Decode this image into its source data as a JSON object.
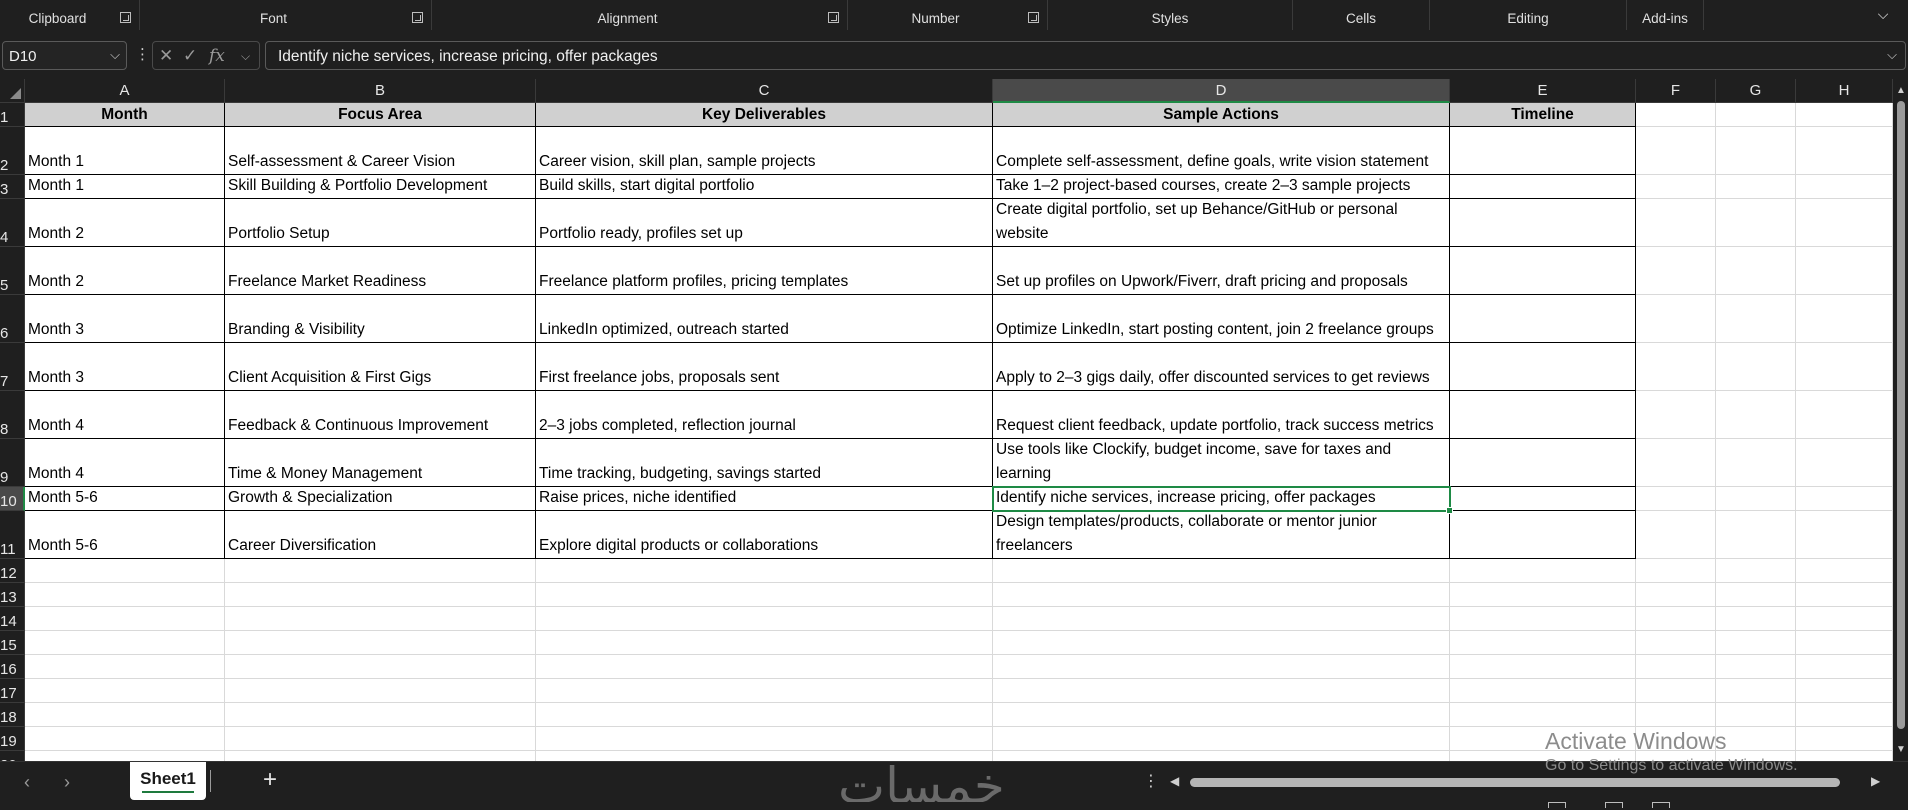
{
  "ribbon": {
    "groups": [
      {
        "label": "Clipboard",
        "launcher": true
      },
      {
        "label": "Font",
        "launcher": true
      },
      {
        "label": "Alignment",
        "launcher": true
      },
      {
        "label": "Number",
        "launcher": true
      },
      {
        "label": "Styles",
        "launcher": false
      },
      {
        "label": "Cells",
        "launcher": false
      },
      {
        "label": "Editing",
        "launcher": false
      },
      {
        "label": "Add-ins",
        "launcher": false
      }
    ],
    "collapse_icon": "chevron-down-icon"
  },
  "formula_bar": {
    "name_box": "D10",
    "formula": "Identify niche services, increase pricing, offer packages",
    "fx_label": "fx"
  },
  "grid": {
    "columns": [
      "A",
      "B",
      "C",
      "D",
      "E",
      "F",
      "G",
      "H"
    ],
    "selected_column": "D",
    "rows": [
      "1",
      "2",
      "3",
      "4",
      "5",
      "6",
      "7",
      "8",
      "9",
      "10",
      "11",
      "12",
      "13",
      "14",
      "15",
      "16",
      "17",
      "18",
      "19",
      "20"
    ],
    "selected_row": "10",
    "headers": [
      "Month",
      "Focus Area",
      "Key Deliverables",
      "Sample Actions",
      "Timeline"
    ],
    "data": [
      [
        "Month 1",
        "Self-assessment & Career Vision",
        "Career vision, skill plan, sample projects",
        "Complete self-assessment, define goals, write vision statement",
        ""
      ],
      [
        "Month 1",
        "Skill Building & Portfolio Development",
        "Build skills, start digital portfolio",
        "Take 1–2 project-based courses, create 2–3 sample projects",
        ""
      ],
      [
        "Month 2",
        "Portfolio Setup",
        "Portfolio ready, profiles set up",
        "Create digital portfolio, set up Behance/GitHub or personal website",
        ""
      ],
      [
        "Month 2",
        "Freelance Market Readiness",
        "Freelance platform profiles, pricing templates",
        "Set up profiles on Upwork/Fiverr, draft pricing and proposals",
        ""
      ],
      [
        "Month 3",
        "Branding & Visibility",
        "LinkedIn optimized, outreach started",
        "Optimize LinkedIn, start posting content, join 2 freelance groups",
        ""
      ],
      [
        "Month 3",
        "Client Acquisition & First Gigs",
        "First freelance jobs, proposals sent",
        "Apply to 2–3 gigs daily, offer discounted services to get reviews",
        ""
      ],
      [
        "Month 4",
        "Feedback & Continuous Improvement",
        "2–3 jobs completed, reflection journal",
        "Request client feedback, update portfolio, track success metrics",
        ""
      ],
      [
        "Month 4",
        "Time & Money Management",
        "Time tracking, budgeting, savings started",
        "Use tools like Clockify, budget income, save for taxes and learning",
        ""
      ],
      [
        "Month 5-6",
        "Growth & Specialization",
        "Raise prices, niche identified",
        "Identify niche services, increase pricing, offer packages",
        ""
      ],
      [
        "Month 5-6",
        "Career Diversification",
        "Explore digital products or collaborations",
        "Design templates/products, collaborate or mentor junior freelancers",
        ""
      ]
    ]
  },
  "sheet_tabs": {
    "active": "Sheet1",
    "add_icon": "plus-icon"
  },
  "watermark": "خمسات",
  "activation": {
    "title": "Activate Windows",
    "subtitle": "Go to Settings to activate Windows."
  },
  "colors": {
    "accent": "#1e8a45",
    "header_fill": "#d0d0d0",
    "chrome": "#1f1f1f"
  }
}
